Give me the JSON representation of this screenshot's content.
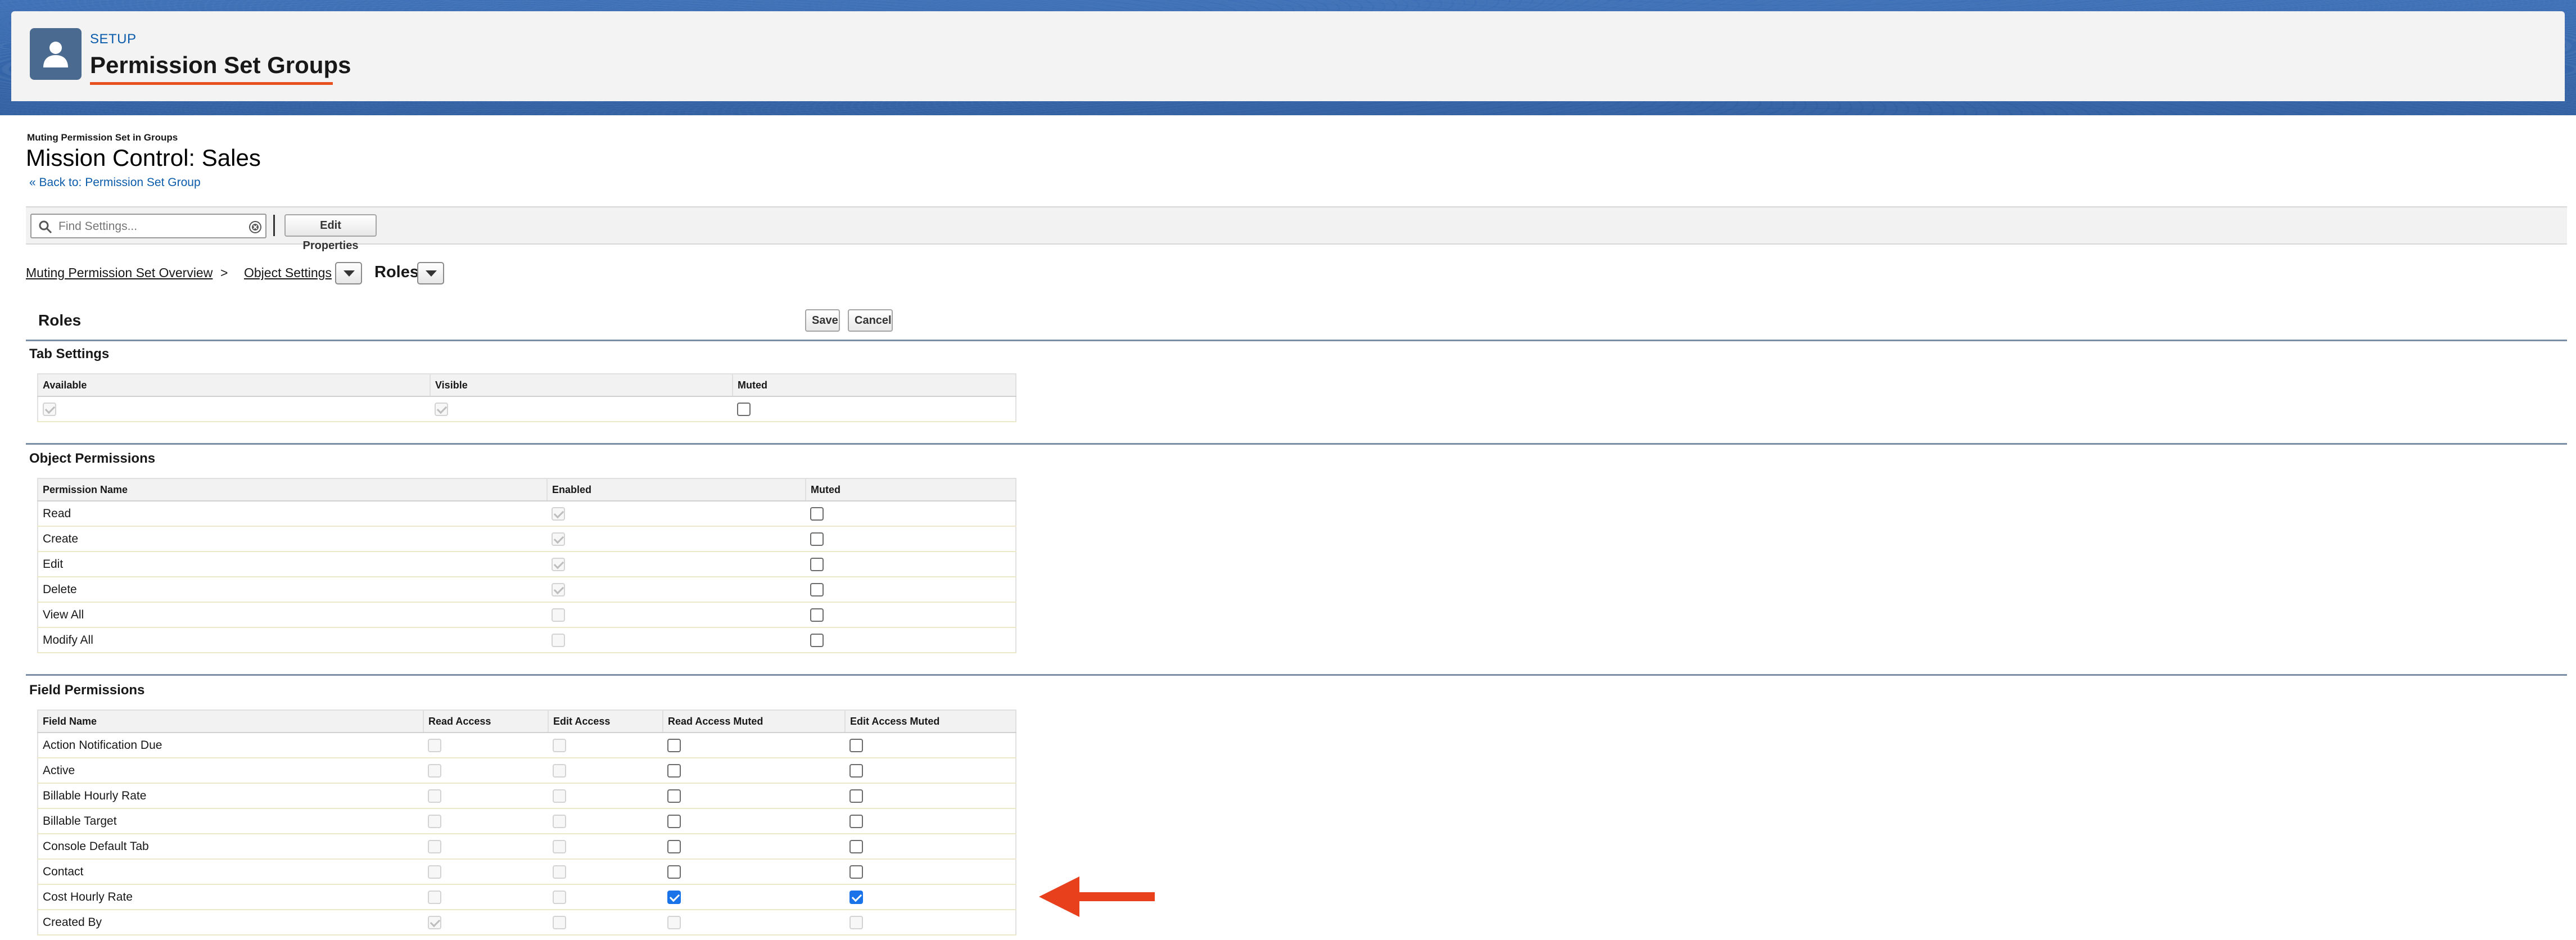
{
  "header": {
    "setup_label": "SETUP",
    "title": "Permission Set Groups",
    "icon": "user-icon"
  },
  "page": {
    "muting_label": "Muting Permission Set in Groups",
    "title": "Mission Control: Sales",
    "back_link": "« Back to: Permission Set Group"
  },
  "toolbar": {
    "search_placeholder": "Find Settings...",
    "edit_properties": "Edit Properties"
  },
  "breadcrumb": {
    "overview": "Muting Permission Set Overview",
    "separator": ">",
    "object_settings": "Object Settings",
    "current": "Roles"
  },
  "roles": {
    "heading": "Roles",
    "save": "Save",
    "cancel": "Cancel"
  },
  "tab_settings": {
    "heading": "Tab Settings",
    "columns": [
      "Available",
      "Visible",
      "Muted"
    ],
    "row": {
      "available": true,
      "visible": true,
      "muted": false
    }
  },
  "object_permissions": {
    "heading": "Object Permissions",
    "columns": [
      "Permission Name",
      "Enabled",
      "Muted"
    ],
    "rows": [
      {
        "name": "Read",
        "enabled": true,
        "muted": false
      },
      {
        "name": "Create",
        "enabled": true,
        "muted": false
      },
      {
        "name": "Edit",
        "enabled": true,
        "muted": false
      },
      {
        "name": "Delete",
        "enabled": true,
        "muted": false
      },
      {
        "name": "View All",
        "enabled": false,
        "muted": false
      },
      {
        "name": "Modify All",
        "enabled": false,
        "muted": false
      }
    ]
  },
  "field_permissions": {
    "heading": "Field Permissions",
    "columns": [
      "Field Name",
      "Read Access",
      "Edit Access",
      "Read Access Muted",
      "Edit Access Muted"
    ],
    "rows": [
      {
        "name": "Action Notification Due",
        "read": false,
        "edit": false,
        "read_muted": false,
        "edit_muted": false,
        "muted_enabled": true
      },
      {
        "name": "Active",
        "read": false,
        "edit": false,
        "read_muted": false,
        "edit_muted": false,
        "muted_enabled": true
      },
      {
        "name": "Billable Hourly Rate",
        "read": false,
        "edit": false,
        "read_muted": false,
        "edit_muted": false,
        "muted_enabled": true
      },
      {
        "name": "Billable Target",
        "read": false,
        "edit": false,
        "read_muted": false,
        "edit_muted": false,
        "muted_enabled": true
      },
      {
        "name": "Console Default Tab",
        "read": false,
        "edit": false,
        "read_muted": false,
        "edit_muted": false,
        "muted_enabled": true
      },
      {
        "name": "Contact",
        "read": false,
        "edit": false,
        "read_muted": false,
        "edit_muted": false,
        "muted_enabled": true
      },
      {
        "name": "Cost Hourly Rate",
        "read": false,
        "edit": false,
        "read_muted": true,
        "edit_muted": true,
        "muted_enabled": true
      },
      {
        "name": "Created By",
        "read": true,
        "edit": false,
        "read_muted": false,
        "edit_muted": false,
        "muted_enabled": false
      }
    ]
  },
  "annotation": {
    "arrow_color": "#e8401c",
    "icon": "left-arrow-icon"
  },
  "colors": {
    "accent": "#0b5cab",
    "underline": "#e8501e",
    "band": "#2f5fa5"
  }
}
